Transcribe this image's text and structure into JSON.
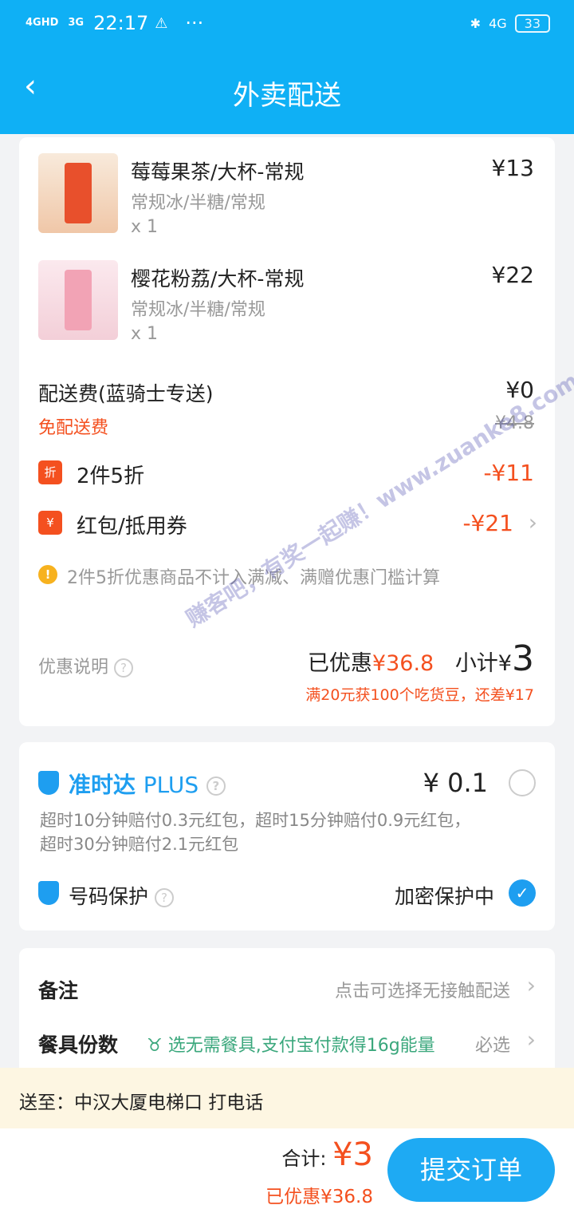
{
  "status_bar": {
    "net1": "4GHD",
    "net2": "3G",
    "time": "22:17",
    "warn": "⚠",
    "dots": "···",
    "bt": "✱",
    "net3": "4G",
    "battery": "33"
  },
  "header": {
    "title": "外卖配送",
    "back": "‹"
  },
  "items": [
    {
      "name": "莓莓果茶/大杯-常规",
      "spec": "常规冰/半糖/常规",
      "qty": "x 1",
      "price": "¥13"
    },
    {
      "name": "樱花粉荔/大杯-常规",
      "spec": "常规冰/半糖/常规",
      "qty": "x 1",
      "price": "¥22"
    }
  ],
  "delivery": {
    "label": "配送费(蓝骑士专送)",
    "price": "¥0",
    "free": "免配送费",
    "original": "¥4.8"
  },
  "discounts": [
    {
      "icon": "折",
      "label": "2件5折",
      "amount": "-¥11"
    },
    {
      "icon": "¥",
      "label": "红包/抵用券",
      "amount": "-¥21"
    }
  ],
  "notice": "2件5折优惠商品不计入满减、满赠优惠门槛计算",
  "summary": {
    "explain": "优惠说明",
    "saved_label": "已优惠",
    "saved": "¥36.8",
    "subtotal_label": "小计¥",
    "subtotal": "3",
    "promo": "满20元获100个吃货豆，还差¥17"
  },
  "ontime": {
    "title": "准时达",
    "plus": "PLUS",
    "price": "¥ 0.1",
    "desc1": "超时10分钟赔付0.3元红包，超时15分钟赔付0.9元红包，",
    "desc2": "超时30分钟赔付2.1元红包",
    "checked": false
  },
  "privacy": {
    "label": "号码保护",
    "status": "加密保护中",
    "checked": true
  },
  "remark": {
    "label": "备注",
    "hint": "点击可选择无接触配送"
  },
  "tableware": {
    "label": "餐具份数",
    "eco": "选无需餐具,支付宝付款得16g能量",
    "required": "必选"
  },
  "address": "送至：中汉大厦电梯口 打电话",
  "footer": {
    "total_label": "合计:",
    "total": "¥3",
    "saved": "已优惠¥36.8",
    "submit": "提交订单"
  },
  "watermark": "赚客吧，有奖一起赚！www.zuanke8.com",
  "colors": {
    "brand": "#0fb0f5",
    "price_red": "#f4501f",
    "eco_green": "#3aa77c"
  }
}
